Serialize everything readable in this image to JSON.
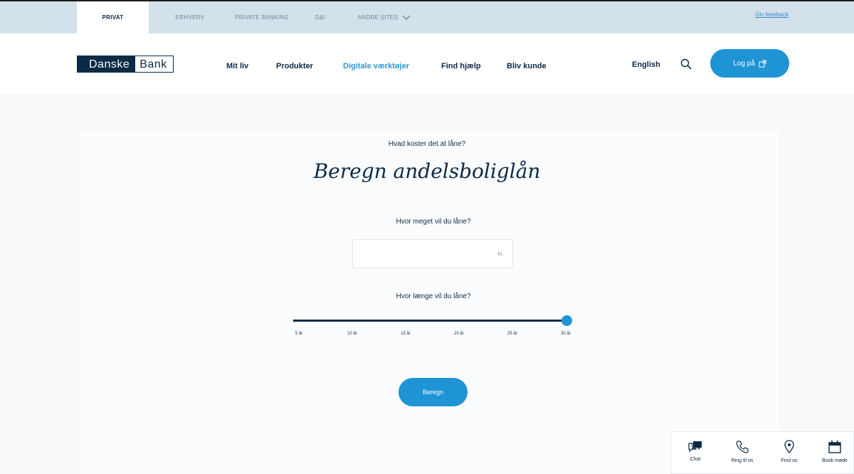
{
  "topbar": {
    "tabs": [
      {
        "label": "PRIVAT",
        "active": true
      },
      {
        "label": "ERHVERV"
      },
      {
        "label": "PRIVATE BANKING"
      },
      {
        "label": "D&I"
      },
      {
        "label": "ANDRE SITES"
      }
    ],
    "feedback": "Giv feedback"
  },
  "header": {
    "logo_left": "Danske",
    "logo_right": "Bank",
    "nav": [
      "Mit liv",
      "Produkter",
      "Digitale værktøjer",
      "Find hjælp",
      "Bliv kunde"
    ],
    "active_nav": "Digitale værktøjer",
    "language": "English",
    "login_label": "Log på"
  },
  "calculator": {
    "subtitle": "Hvad koster det at låne?",
    "title": "Beregn andelsboliglån",
    "amount_question": "Hvor meget vil du låne?",
    "amount_value": "",
    "amount_unit": "kr.",
    "term_question": "Hvor længe vil du låne?",
    "term_ticks": [
      "5 år",
      "10 år",
      "15 år",
      "20 år",
      "25 år",
      "30 år"
    ],
    "term_selected_years": 30,
    "calculate_label": "Beregn"
  },
  "contact": {
    "items": [
      {
        "label": "Chat",
        "icon": "chat-icon"
      },
      {
        "label": "Ring til os",
        "icon": "phone-icon"
      },
      {
        "label": "Find os",
        "icon": "location-pin-icon"
      },
      {
        "label": "Book møde",
        "icon": "calendar-icon"
      }
    ]
  },
  "colors": {
    "navy": "#0b2a45",
    "accent": "#1f94d5",
    "topbar": "#d2e1ea"
  }
}
